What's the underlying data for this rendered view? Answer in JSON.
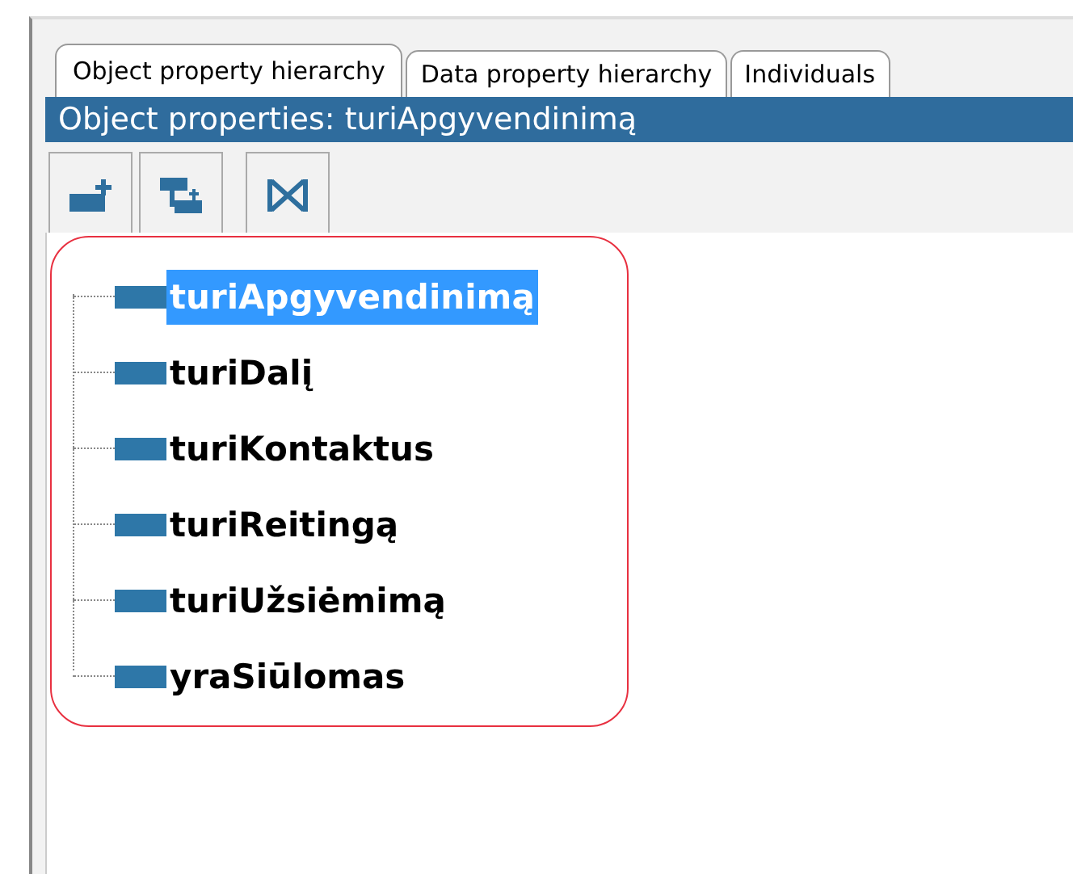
{
  "tabs": [
    {
      "label": "Object property hierarchy",
      "selected": true
    },
    {
      "label": "Data property hierarchy",
      "selected": false
    },
    {
      "label": "Individuals",
      "selected": false
    }
  ],
  "header": {
    "title": "Object properties: turiApgyvendinimą"
  },
  "toolbar": [
    {
      "kind": "add-sub"
    },
    {
      "kind": "add-sibling"
    },
    {
      "kind": "delete"
    }
  ],
  "tree": {
    "items": [
      {
        "label": "turiApgyvendinimą",
        "selected": true
      },
      {
        "label": "turiDalį",
        "selected": false
      },
      {
        "label": "turiKontaktus",
        "selected": false
      },
      {
        "label": "turiReitingą",
        "selected": false
      },
      {
        "label": "turiUžsiėmimą",
        "selected": false
      },
      {
        "label": "yraSiūlomas",
        "selected": false
      }
    ]
  }
}
